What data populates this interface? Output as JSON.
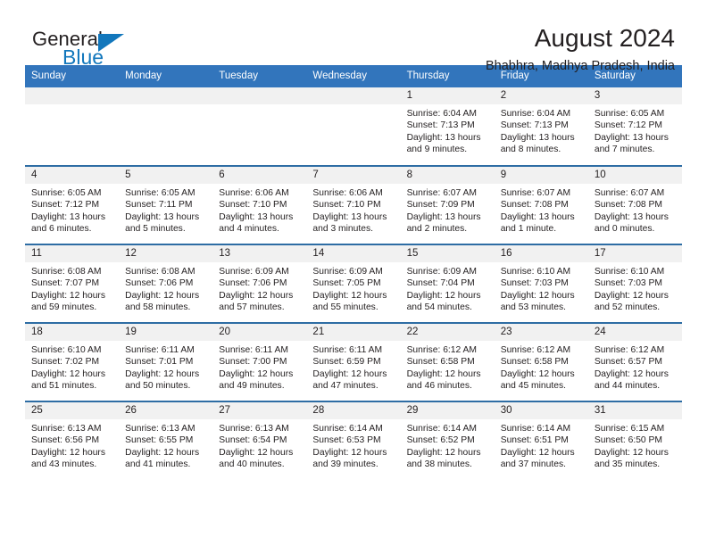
{
  "logo": {
    "word_one": "General",
    "word_two": "Blue",
    "triangle_color": "#1277bc",
    "text_color": "#231f20"
  },
  "header": {
    "title": "August 2024",
    "subtitle": "Bhabhra, Madhya Pradesh, India"
  },
  "theme": {
    "header_blue": "#3275bc",
    "divider_blue": "#2e6da4",
    "date_strip_gray": "#f1f1f1",
    "text": "#231f20"
  },
  "calendar": {
    "day_headers": [
      "Sunday",
      "Monday",
      "Tuesday",
      "Wednesday",
      "Thursday",
      "Friday",
      "Saturday"
    ],
    "weeks": [
      [
        {
          "date": "",
          "empty": true
        },
        {
          "date": "",
          "empty": true
        },
        {
          "date": "",
          "empty": true
        },
        {
          "date": "",
          "empty": true
        },
        {
          "date": "1",
          "sunrise": "Sunrise: 6:04 AM",
          "sunset": "Sunset: 7:13 PM",
          "daylight": "Daylight: 13 hours and 9 minutes."
        },
        {
          "date": "2",
          "sunrise": "Sunrise: 6:04 AM",
          "sunset": "Sunset: 7:13 PM",
          "daylight": "Daylight: 13 hours and 8 minutes."
        },
        {
          "date": "3",
          "sunrise": "Sunrise: 6:05 AM",
          "sunset": "Sunset: 7:12 PM",
          "daylight": "Daylight: 13 hours and 7 minutes."
        }
      ],
      [
        {
          "date": "4",
          "sunrise": "Sunrise: 6:05 AM",
          "sunset": "Sunset: 7:12 PM",
          "daylight": "Daylight: 13 hours and 6 minutes."
        },
        {
          "date": "5",
          "sunrise": "Sunrise: 6:05 AM",
          "sunset": "Sunset: 7:11 PM",
          "daylight": "Daylight: 13 hours and 5 minutes."
        },
        {
          "date": "6",
          "sunrise": "Sunrise: 6:06 AM",
          "sunset": "Sunset: 7:10 PM",
          "daylight": "Daylight: 13 hours and 4 minutes."
        },
        {
          "date": "7",
          "sunrise": "Sunrise: 6:06 AM",
          "sunset": "Sunset: 7:10 PM",
          "daylight": "Daylight: 13 hours and 3 minutes."
        },
        {
          "date": "8",
          "sunrise": "Sunrise: 6:07 AM",
          "sunset": "Sunset: 7:09 PM",
          "daylight": "Daylight: 13 hours and 2 minutes."
        },
        {
          "date": "9",
          "sunrise": "Sunrise: 6:07 AM",
          "sunset": "Sunset: 7:08 PM",
          "daylight": "Daylight: 13 hours and 1 minute."
        },
        {
          "date": "10",
          "sunrise": "Sunrise: 6:07 AM",
          "sunset": "Sunset: 7:08 PM",
          "daylight": "Daylight: 13 hours and 0 minutes."
        }
      ],
      [
        {
          "date": "11",
          "sunrise": "Sunrise: 6:08 AM",
          "sunset": "Sunset: 7:07 PM",
          "daylight": "Daylight: 12 hours and 59 minutes."
        },
        {
          "date": "12",
          "sunrise": "Sunrise: 6:08 AM",
          "sunset": "Sunset: 7:06 PM",
          "daylight": "Daylight: 12 hours and 58 minutes."
        },
        {
          "date": "13",
          "sunrise": "Sunrise: 6:09 AM",
          "sunset": "Sunset: 7:06 PM",
          "daylight": "Daylight: 12 hours and 57 minutes."
        },
        {
          "date": "14",
          "sunrise": "Sunrise: 6:09 AM",
          "sunset": "Sunset: 7:05 PM",
          "daylight": "Daylight: 12 hours and 55 minutes."
        },
        {
          "date": "15",
          "sunrise": "Sunrise: 6:09 AM",
          "sunset": "Sunset: 7:04 PM",
          "daylight": "Daylight: 12 hours and 54 minutes."
        },
        {
          "date": "16",
          "sunrise": "Sunrise: 6:10 AM",
          "sunset": "Sunset: 7:03 PM",
          "daylight": "Daylight: 12 hours and 53 minutes."
        },
        {
          "date": "17",
          "sunrise": "Sunrise: 6:10 AM",
          "sunset": "Sunset: 7:03 PM",
          "daylight": "Daylight: 12 hours and 52 minutes."
        }
      ],
      [
        {
          "date": "18",
          "sunrise": "Sunrise: 6:10 AM",
          "sunset": "Sunset: 7:02 PM",
          "daylight": "Daylight: 12 hours and 51 minutes."
        },
        {
          "date": "19",
          "sunrise": "Sunrise: 6:11 AM",
          "sunset": "Sunset: 7:01 PM",
          "daylight": "Daylight: 12 hours and 50 minutes."
        },
        {
          "date": "20",
          "sunrise": "Sunrise: 6:11 AM",
          "sunset": "Sunset: 7:00 PM",
          "daylight": "Daylight: 12 hours and 49 minutes."
        },
        {
          "date": "21",
          "sunrise": "Sunrise: 6:11 AM",
          "sunset": "Sunset: 6:59 PM",
          "daylight": "Daylight: 12 hours and 47 minutes."
        },
        {
          "date": "22",
          "sunrise": "Sunrise: 6:12 AM",
          "sunset": "Sunset: 6:58 PM",
          "daylight": "Daylight: 12 hours and 46 minutes."
        },
        {
          "date": "23",
          "sunrise": "Sunrise: 6:12 AM",
          "sunset": "Sunset: 6:58 PM",
          "daylight": "Daylight: 12 hours and 45 minutes."
        },
        {
          "date": "24",
          "sunrise": "Sunrise: 6:12 AM",
          "sunset": "Sunset: 6:57 PM",
          "daylight": "Daylight: 12 hours and 44 minutes."
        }
      ],
      [
        {
          "date": "25",
          "sunrise": "Sunrise: 6:13 AM",
          "sunset": "Sunset: 6:56 PM",
          "daylight": "Daylight: 12 hours and 43 minutes."
        },
        {
          "date": "26",
          "sunrise": "Sunrise: 6:13 AM",
          "sunset": "Sunset: 6:55 PM",
          "daylight": "Daylight: 12 hours and 41 minutes."
        },
        {
          "date": "27",
          "sunrise": "Sunrise: 6:13 AM",
          "sunset": "Sunset: 6:54 PM",
          "daylight": "Daylight: 12 hours and 40 minutes."
        },
        {
          "date": "28",
          "sunrise": "Sunrise: 6:14 AM",
          "sunset": "Sunset: 6:53 PM",
          "daylight": "Daylight: 12 hours and 39 minutes."
        },
        {
          "date": "29",
          "sunrise": "Sunrise: 6:14 AM",
          "sunset": "Sunset: 6:52 PM",
          "daylight": "Daylight: 12 hours and 38 minutes."
        },
        {
          "date": "30",
          "sunrise": "Sunrise: 6:14 AM",
          "sunset": "Sunset: 6:51 PM",
          "daylight": "Daylight: 12 hours and 37 minutes."
        },
        {
          "date": "31",
          "sunrise": "Sunrise: 6:15 AM",
          "sunset": "Sunset: 6:50 PM",
          "daylight": "Daylight: 12 hours and 35 minutes."
        }
      ]
    ]
  }
}
